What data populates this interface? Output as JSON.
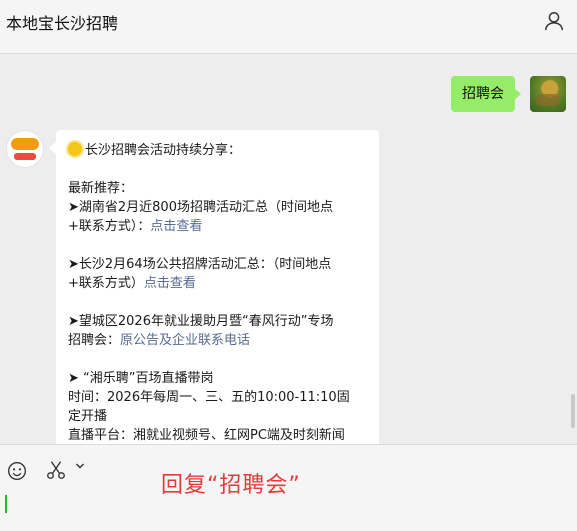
{
  "header": {
    "title": "本地宝长沙招聘",
    "profile_icon": "person-icon"
  },
  "messages": {
    "sent_keyword": "招聘会",
    "article": {
      "title": "长沙招聘会活动持续分享：",
      "latest_label": "最新推荐：",
      "item1_line1": "➤湖南省2月近800场招聘活动汇总（时间地点",
      "item1_line2": "+联系方式）：",
      "item1_link": "点击查看",
      "item2_line1": "➤长沙2月64场公共招牌活动汇总：（时间地点",
      "item2_line2": "+联系方式）",
      "item2_link": "点击查看",
      "item3_line1": "➤望城区2026年就业援助月暨“春风行动”专场",
      "item3_line2": "招聘会：",
      "item3_link": "原公告及企业联系电话",
      "item4_line1": "➤ “湘乐聘”百场直播带岗",
      "item4_line2": "时间：2026年每周一、三、五的10:00-11:10固",
      "item4_line3": "定开播",
      "item4_line4": "直播平台：湘就业视频号、红网PC端及时刻新闻"
    }
  },
  "composer": {
    "reply_hint": "回复“招聘会”",
    "icons": [
      "emoji-icon",
      "scissors-icon",
      "chevron-down-icon"
    ]
  },
  "colors": {
    "sent_bubble": "#95ec69",
    "link": "#576b95",
    "hint": "#e33b3b"
  }
}
